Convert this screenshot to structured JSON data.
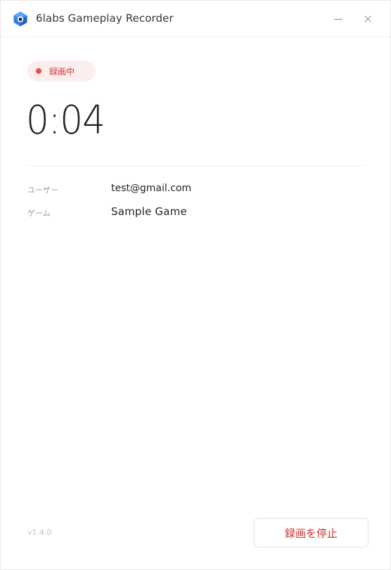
{
  "window": {
    "title": "6labs Gameplay Recorder",
    "logo_icon": "6labs-hexagon-logo",
    "minimize_icon": "minimize-icon",
    "close_icon": "close-icon"
  },
  "status": {
    "label": "録画中",
    "dot_color": "#e84c4c",
    "background_color": "#fdeeee"
  },
  "timer": {
    "elapsed": "0:04"
  },
  "info": {
    "user_label": "ユーザー",
    "user_value": "test@gmail.com",
    "game_label": "ゲーム",
    "game_value": "Sample Game"
  },
  "footer": {
    "version": "v1.4.0",
    "stop_label": "録画を停止"
  },
  "colors": {
    "accent_red": "#d42f2f",
    "logo_blue": "#2f7fe6"
  }
}
